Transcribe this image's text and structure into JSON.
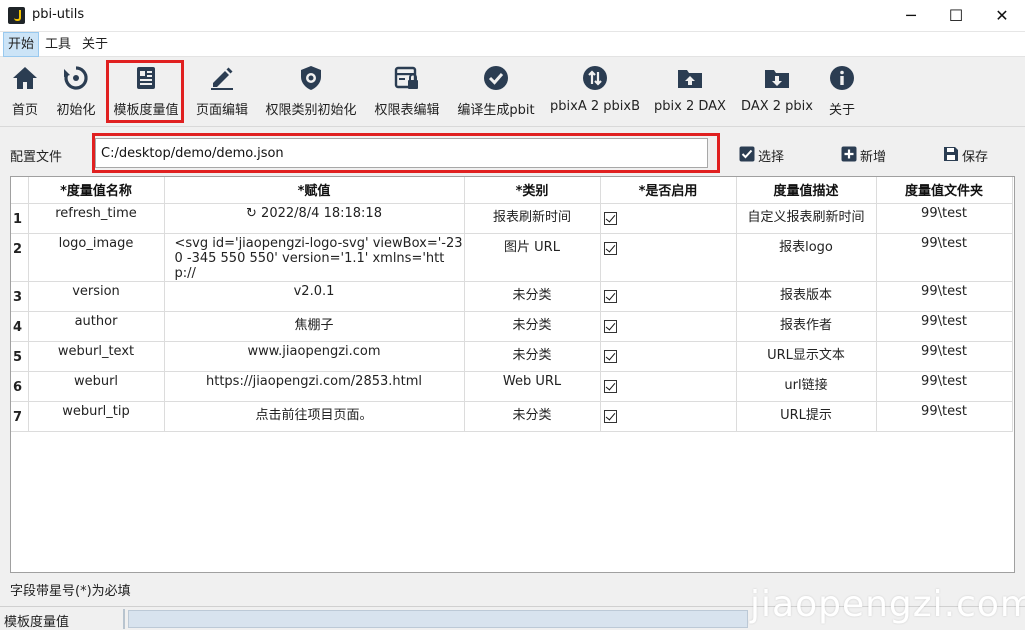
{
  "window": {
    "title": "pbi-utils",
    "minimize": "─",
    "maximize": "☐",
    "close": "✕"
  },
  "menu": [
    "开始",
    "工具",
    "关于"
  ],
  "toolbar": [
    {
      "label": "首页",
      "icon": "home-icon"
    },
    {
      "label": "初始化",
      "icon": "reset-icon"
    },
    {
      "label": "模板度量值",
      "icon": "template-measure-icon"
    },
    {
      "label": "页面编辑",
      "icon": "pencil-icon"
    },
    {
      "label": "权限类别初始化",
      "icon": "shield-gear-icon"
    },
    {
      "label": "权限表编辑",
      "icon": "lock-table-icon"
    },
    {
      "label": "编译生成pbit",
      "icon": "check-circle-icon"
    },
    {
      "label": "pbixA 2 pbixB",
      "icon": "swap-circle-icon"
    },
    {
      "label": "pbix 2 DAX",
      "icon": "folder-upload-icon"
    },
    {
      "label": "DAX 2 pbix",
      "icon": "folder-download-icon"
    },
    {
      "label": "关于",
      "icon": "info-icon"
    }
  ],
  "config": {
    "label": "配置文件",
    "value": "C:/desktop/demo/demo.json",
    "select": "选择",
    "add": "新增",
    "save": "保存"
  },
  "table": {
    "headers": [
      "*度量值名称",
      "*赋值",
      "*类别",
      "*是否启用",
      "度量值描述",
      "度量值文件夹"
    ],
    "rows": [
      {
        "num": "1",
        "name": "refresh_time",
        "value": "↻ 2022/8/4 18:18:18",
        "category": "报表刷新时间",
        "enabled": true,
        "desc": "自定义报表刷新时间",
        "folder": "99\\test"
      },
      {
        "num": "2",
        "name": "logo_image",
        "value": "<svg id='jiaopengzi-logo-svg' viewBox='-230 -345 550 550' version='1.1' xmlns='http://",
        "category": "图片 URL",
        "enabled": true,
        "desc": "报表logo",
        "folder": "99\\test"
      },
      {
        "num": "3",
        "name": "version",
        "value": "v2.0.1",
        "category": "未分类",
        "enabled": true,
        "desc": "报表版本",
        "folder": "99\\test"
      },
      {
        "num": "4",
        "name": "author",
        "value": "焦棚子",
        "category": "未分类",
        "enabled": true,
        "desc": "报表作者",
        "folder": "99\\test"
      },
      {
        "num": "5",
        "name": "weburl_text",
        "value": "www.jiaopengzi.com",
        "category": "未分类",
        "enabled": true,
        "desc": "URL显示文本",
        "folder": "99\\test"
      },
      {
        "num": "6",
        "name": "weburl",
        "value": "https://jiaopengzi.com/2853.html",
        "category": "Web URL",
        "enabled": true,
        "desc": "url链接",
        "folder": "99\\test"
      },
      {
        "num": "7",
        "name": "weburl_tip",
        "value": "点击前往项目页面。",
        "category": "未分类",
        "enabled": true,
        "desc": "URL提示",
        "folder": "99\\test"
      }
    ]
  },
  "hint": "字段带星号(*)为必填",
  "status": {
    "text": "模板度量值"
  },
  "watermark": "jiaopengzi.com",
  "colors": {
    "accent": "#2b3d52",
    "highlight": "#e02020"
  }
}
